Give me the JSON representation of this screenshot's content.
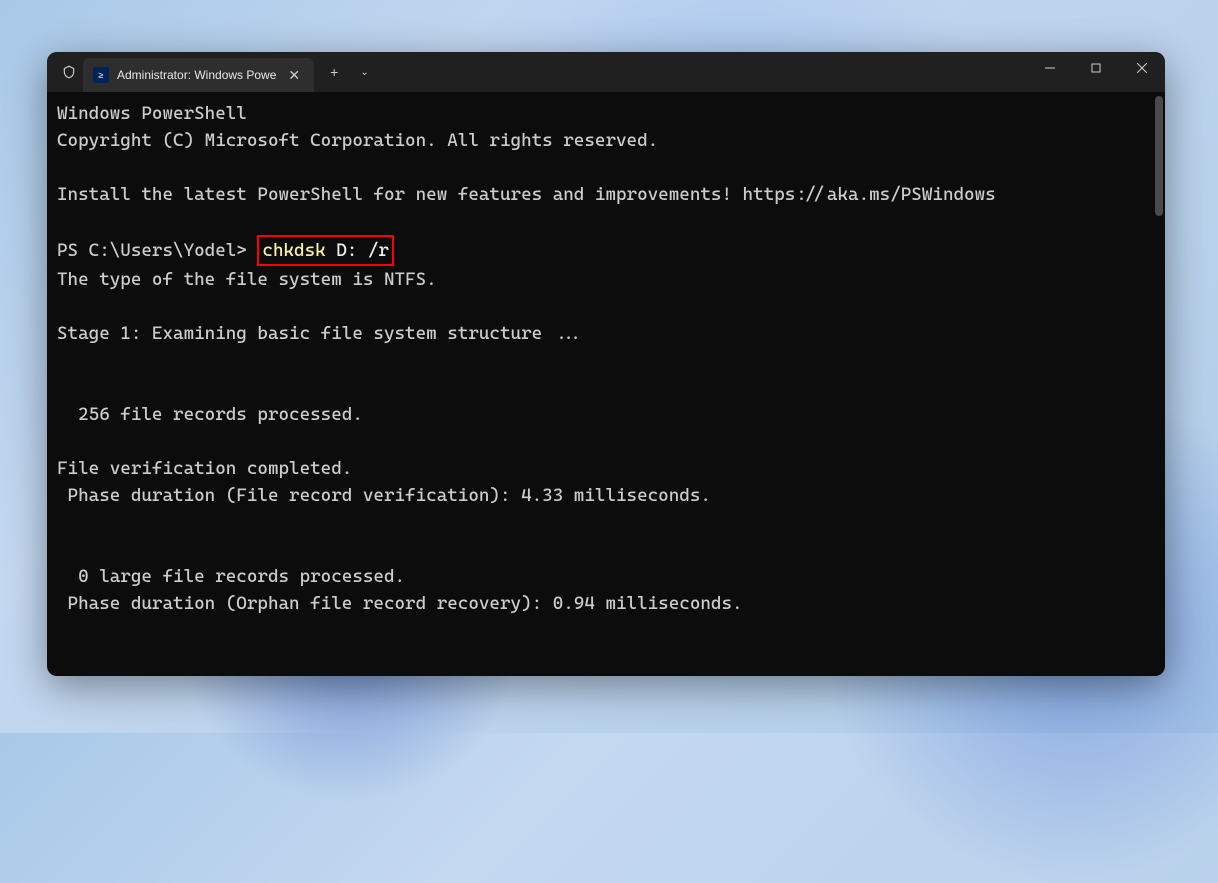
{
  "window": {
    "tab_title": "Administrator: Windows Powe",
    "tab_icon_char": "≥",
    "new_tab_label": "+",
    "dropdown_label": "⌄"
  },
  "terminal": {
    "line1": "Windows PowerShell",
    "line2": "Copyright (C) Microsoft Corporation. All rights reserved.",
    "line4": "Install the latest PowerShell for new features and improvements! https://aka.ms/PSWindows",
    "prompt": "PS C:\\Users\\Yodel> ",
    "command_cmd": "chkdsk",
    "command_args": " D: /r",
    "line7": "The type of the file system is NTFS.",
    "line9": "Stage 1: Examining basic file system structure ...",
    "line12": "  256 file records processed.",
    "line14": "File verification completed.",
    "line15": " Phase duration (File record verification): 4.33 milliseconds.",
    "line18": "  0 large file records processed.",
    "line19": " Phase duration (Orphan file record recovery): 0.94 milliseconds."
  }
}
